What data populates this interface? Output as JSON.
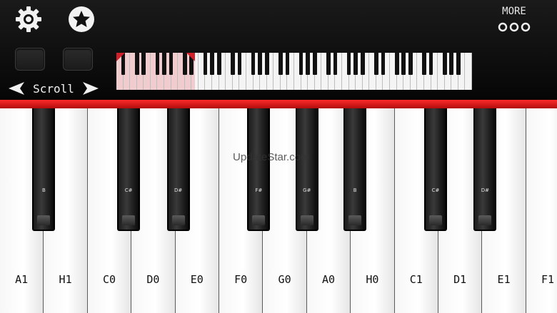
{
  "toolbar": {
    "more_label": "MORE",
    "scroll_label": "Scroll",
    "settings_icon": "gear-icon",
    "favorite_icon": "star-icon"
  },
  "mini_keyboard": {
    "white_key_count": 52,
    "highlight_fraction": 0.22,
    "accent_color": "#d0202a"
  },
  "keys": {
    "white": [
      "A1",
      "H1",
      "C0",
      "D0",
      "E0",
      "F0",
      "G0",
      "A0",
      "H0",
      "C1",
      "D1",
      "E1",
      "F1"
    ],
    "black": [
      "B",
      "C#",
      "D#",
      "F#",
      "G#",
      "B",
      "C#",
      "D#"
    ]
  },
  "watermark": "UpdateStar.com",
  "colors": {
    "red_bar": "#d0202a",
    "background": "#111111"
  }
}
